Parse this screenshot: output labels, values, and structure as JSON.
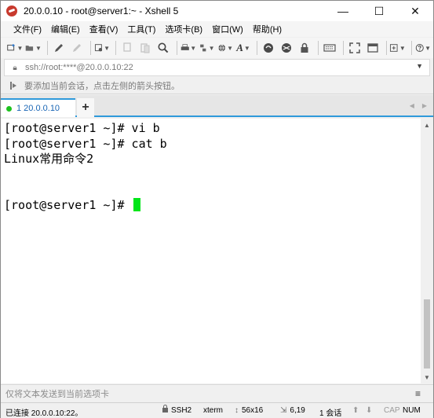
{
  "window": {
    "title": "20.0.0.10 - root@server1:~ - Xshell 5",
    "controls": [
      "—",
      "☐",
      "✕"
    ]
  },
  "menu": {
    "items": [
      "文件(F)",
      "编辑(E)",
      "查看(V)",
      "工具(T)",
      "选项卡(B)",
      "窗口(W)",
      "帮助(H)"
    ]
  },
  "toolbar": {
    "icons": [
      "new-session-icon",
      "open-folder-icon",
      "pen-icon",
      "disconnect-icon",
      "properties-icon",
      "copy-icon",
      "paste-icon",
      "find-icon",
      "print-icon",
      "transfer-icon",
      "globe-icon",
      "font-icon",
      "xftp-icon",
      "xmanager-icon",
      "lock-icon",
      "keyboard-icon",
      "fullscreen-icon",
      "new-window-icon",
      "help-icon"
    ]
  },
  "address": {
    "text": "ssh://root:****@20.0.0.10:22"
  },
  "hint": {
    "text": "要添加当前会话，点击左侧的箭头按钮。"
  },
  "tabs": [
    {
      "label": "1 20.0.0.10",
      "status_color": "#1ec21e"
    }
  ],
  "terminal": {
    "lines": [
      "[root@server1 ~]# vi b",
      "[root@server1 ~]# cat b",
      "Linux常用命令2",
      "",
      "",
      "[root@server1 ~]# "
    ],
    "cursor_color": "#00e51a"
  },
  "sendbar": {
    "placeholder": "仅将文本发送到当前选项卡"
  },
  "status": {
    "connection": "已连接 20.0.0.10:22。",
    "protocol": "SSH2",
    "term": "xterm",
    "size": "56x16",
    "position": "6,19",
    "sessions": "1 会话",
    "caps": "CAP",
    "num": "NUM"
  },
  "colors": {
    "accent": "#2f9adb",
    "tab_text": "#1a66b5"
  }
}
